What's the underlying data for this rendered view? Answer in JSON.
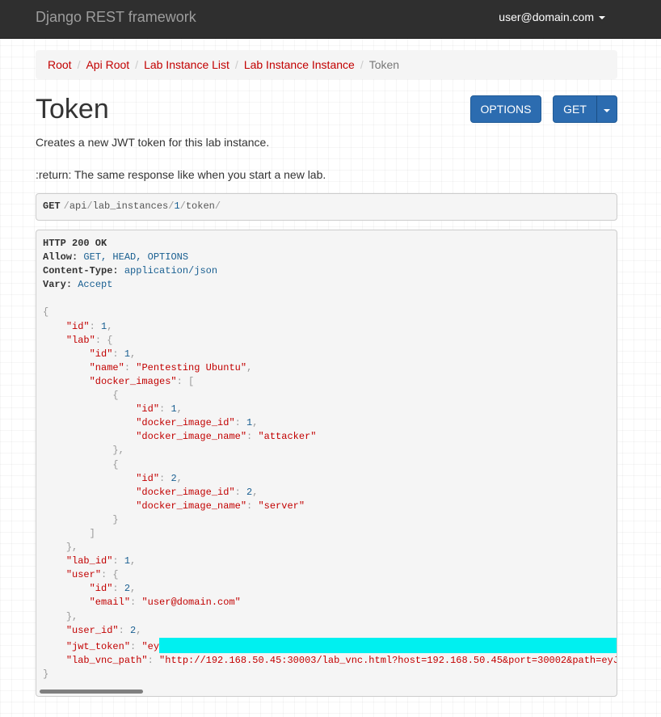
{
  "navbar": {
    "brand": "Django REST framework",
    "user": "user@domain.com"
  },
  "breadcrumb": {
    "items": [
      "Root",
      "Api Root",
      "Lab Instance List",
      "Lab Instance Instance"
    ],
    "active": "Token"
  },
  "page": {
    "title": "Token",
    "description": [
      "Creates a new JWT token for this lab instance.",
      ":return: The same response like when you start a new lab."
    ]
  },
  "buttons": {
    "options": "OPTIONS",
    "get": "GET"
  },
  "request": {
    "method": "GET",
    "path_segments": [
      "api",
      "lab_instances",
      "1",
      "token"
    ]
  },
  "response": {
    "status": "HTTP 200 OK",
    "headers": [
      {
        "key": "Allow",
        "value": "GET, HEAD, OPTIONS"
      },
      {
        "key": "Content-Type",
        "value": "application/json"
      },
      {
        "key": "Vary",
        "value": "Accept"
      }
    ],
    "body": {
      "id": 1,
      "lab": {
        "id": 1,
        "name": "Pentesting Ubuntu",
        "docker_images": [
          {
            "id": 1,
            "docker_image_id": 1,
            "docker_image_name": "attacker"
          },
          {
            "id": 2,
            "docker_image_id": 2,
            "docker_image_name": "server"
          }
        ]
      },
      "lab_id": 1,
      "user": {
        "id": 2,
        "email": "user@domain.com"
      },
      "user_id": 2,
      "jwt_token_visible": "ey",
      "lab_vnc_path_visible": "http://192.168.50.45:30003/lab_vnc.html?host=192.168.50.45&port=30002&path=eyJ"
    }
  },
  "colors": {
    "navbar": "#2f2f2f",
    "accent": "#c20000",
    "button": "#2c6cb0",
    "redaction": "#00f0f0"
  }
}
